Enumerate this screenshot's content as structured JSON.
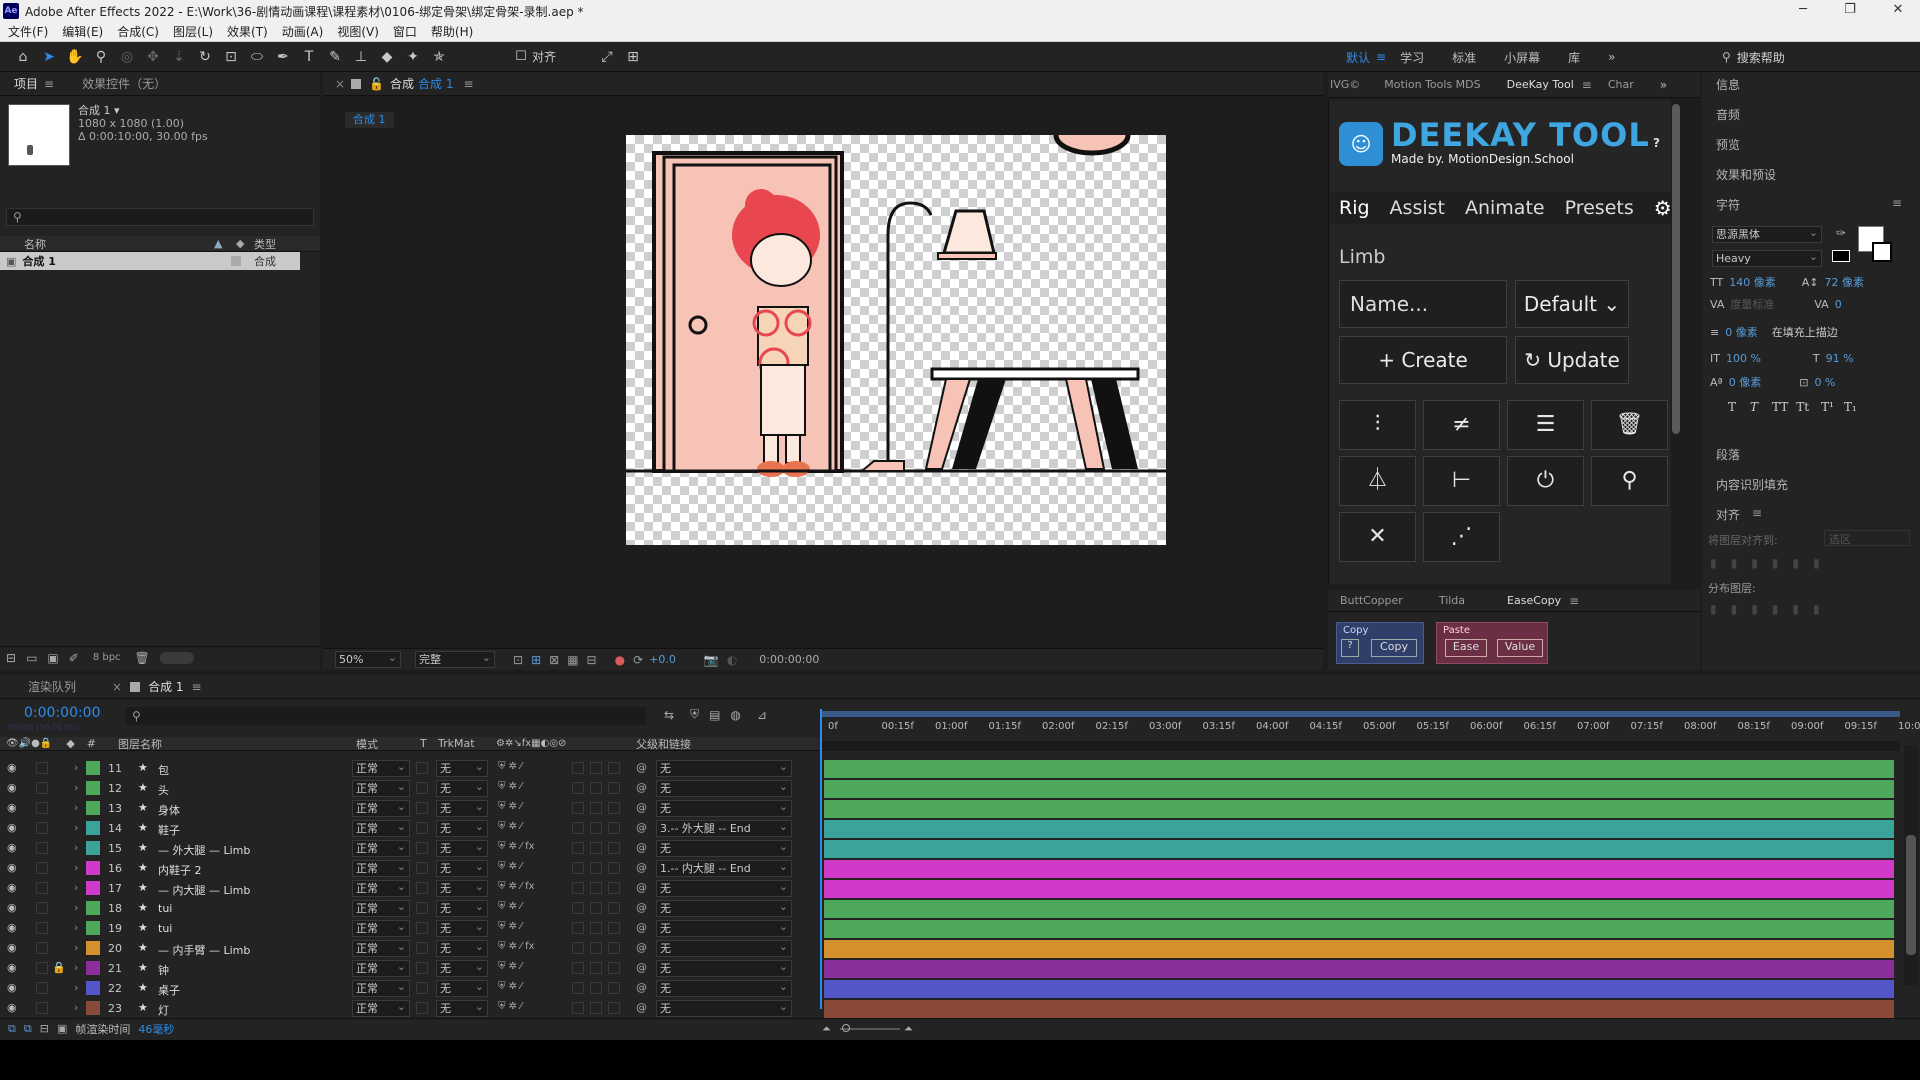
{
  "window": {
    "title": "Adobe After Effects 2022 - E:\\Work\\36-剧情动画课程\\课程素材\\0106-绑定骨架\\绑定骨架-录制.aep *",
    "logo": "Ae"
  },
  "menu": [
    "文件(F)",
    "编辑(E)",
    "合成(C)",
    "图层(L)",
    "效果(T)",
    "动画(A)",
    "视图(V)",
    "窗口",
    "帮助(H)"
  ],
  "toolbar": {
    "align_label": "对齐",
    "workspaces": [
      "默认",
      "学习",
      "标准",
      "小屏幕",
      "库"
    ],
    "active_workspace": "默认",
    "search_help": "搜索帮助"
  },
  "project": {
    "tab_project": "项目",
    "tab_effects": "效果控件（无）",
    "comp_name": "合成 1",
    "comp_size": "1080 x 1080 (1.00)",
    "comp_duration": "Δ 0:00:10:00, 30.00 fps",
    "col_name": "名称",
    "col_type": "类型",
    "item_name": "合成 1",
    "item_type": "合成",
    "bpc": "8 bpc"
  },
  "viewer": {
    "tab_label": "合成",
    "comp_link": "合成 1",
    "breadcrumb": "合成 1",
    "zoom": "50%",
    "resolution": "完整",
    "exposure": "+0.0",
    "timecode": "0:00:00:00"
  },
  "deekay": {
    "tabs": [
      "IVG©",
      "Motion Tools MDS",
      "DeeKay Tool",
      "Char"
    ],
    "active_tab": "DeeKay Tool",
    "logo_title": "DEEKAY TOOL",
    "logo_sub": "Made by. MotionDesign.School",
    "help": "?",
    "nav": [
      "Rig",
      "Assist",
      "Animate",
      "Presets"
    ],
    "section": "Limb",
    "name_placeholder": "Name...",
    "preset": "Default",
    "create": "Create",
    "update": "Update",
    "icons": [
      "bone-chain-icon",
      "not-equal-icon",
      "menu-cursor-icon",
      "trash-icon",
      "flask-icon",
      "axis-plus-icon",
      "power-icon",
      "pin-icon",
      "scissors-icon",
      "branch-icon"
    ]
  },
  "buttcopper": {
    "tabs": [
      "ButtCopper",
      "Tilda",
      "EaseCopy"
    ],
    "active": "EaseCopy",
    "copy_title": "Copy",
    "paste_title": "Paste",
    "help": "?",
    "copy_btn": "Copy",
    "ease_btn": "Ease",
    "value_btn": "Value"
  },
  "right_panel": {
    "items": [
      "信息",
      "音频",
      "预览",
      "效果和预设"
    ],
    "char_title": "字符",
    "font": "思源黑体",
    "weight": "Heavy",
    "size": "140 像素",
    "leading": "72 像素",
    "tracking_label": "度量标准",
    "tracking": "0",
    "stroke": "0 像素",
    "stroke_mode": "在填充上描边",
    "vscale": "100 %",
    "hscale": "91 %",
    "baseline": "0 像素",
    "tsume": "0 %",
    "styles": [
      "T",
      "T",
      "TT",
      "Tt",
      "T¹",
      "T₁"
    ],
    "para": "段落",
    "content_fill": "内容识别填充",
    "align_title": "对齐",
    "align_to": "将图层对齐到:",
    "align_target": "选区",
    "distribute": "分布图层:"
  },
  "timeline": {
    "tab_render": "渲染队列",
    "tab_comp": "合成 1",
    "timecode": "0:00:00:00",
    "timecode_sub": "00000 (30.00 fps)",
    "headers": {
      "num": "#",
      "name": "图层名称",
      "mode": "模式",
      "t": "T",
      "trkmat": "TrkMat",
      "parent": "父级和链接"
    },
    "ruler": [
      "0f",
      "00:15f",
      "01:00f",
      "01:15f",
      "02:00f",
      "02:15f",
      "03:00f",
      "03:15f",
      "04:00f",
      "04:15f",
      "05:00f",
      "05:15f",
      "06:00f",
      "06:15f",
      "07:00f",
      "07:15f",
      "08:00f",
      "08:15f",
      "09:00f",
      "09:15f",
      "10:0"
    ],
    "layers": [
      {
        "num": "11",
        "name": "包",
        "mode": "正常",
        "trk": "无",
        "parent": "无",
        "color": "#4ea859",
        "locked": false,
        "fx": false
      },
      {
        "num": "12",
        "name": "头",
        "mode": "正常",
        "trk": "无",
        "parent": "无",
        "color": "#4ea859",
        "locked": false,
        "fx": false
      },
      {
        "num": "13",
        "name": "身体",
        "mode": "正常",
        "trk": "无",
        "parent": "无",
        "color": "#4ea859",
        "locked": false,
        "fx": false
      },
      {
        "num": "14",
        "name": "鞋子",
        "mode": "正常",
        "trk": "无",
        "parent": "3.-- 外大腿 -- End",
        "color": "#3aa39a",
        "locked": false,
        "fx": false
      },
      {
        "num": "15",
        "name": "— 外大腿 — Limb",
        "mode": "正常",
        "trk": "无",
        "parent": "无",
        "color": "#3aa39a",
        "locked": false,
        "fx": true
      },
      {
        "num": "16",
        "name": "内鞋子 2",
        "mode": "正常",
        "trk": "无",
        "parent": "1.-- 内大腿 -- End",
        "color": "#d13ac8",
        "locked": false,
        "fx": false
      },
      {
        "num": "17",
        "name": "— 内大腿 — Limb",
        "mode": "正常",
        "trk": "无",
        "parent": "无",
        "color": "#d13ac8",
        "locked": false,
        "fx": true
      },
      {
        "num": "18",
        "name": "tui",
        "mode": "正常",
        "trk": "无",
        "parent": "无",
        "color": "#4ea859",
        "locked": false,
        "fx": false
      },
      {
        "num": "19",
        "name": "tui",
        "mode": "正常",
        "trk": "无",
        "parent": "无",
        "color": "#4ea859",
        "locked": false,
        "fx": false
      },
      {
        "num": "20",
        "name": "— 内手臂 — Limb",
        "mode": "正常",
        "trk": "无",
        "parent": "无",
        "color": "#d4902c",
        "locked": false,
        "fx": true
      },
      {
        "num": "21",
        "name": "钟",
        "mode": "正常",
        "trk": "无",
        "parent": "无",
        "color": "#8a2f9a",
        "locked": true,
        "fx": false
      },
      {
        "num": "22",
        "name": "桌子",
        "mode": "正常",
        "trk": "无",
        "parent": "无",
        "color": "#5556c8",
        "locked": false,
        "fx": false
      },
      {
        "num": "23",
        "name": "灯",
        "mode": "正常",
        "trk": "无",
        "parent": "无",
        "color": "#8a4a3a",
        "locked": false,
        "fx": false
      }
    ],
    "footer_label": "帧渲染时间",
    "footer_value": "46毫秒"
  }
}
